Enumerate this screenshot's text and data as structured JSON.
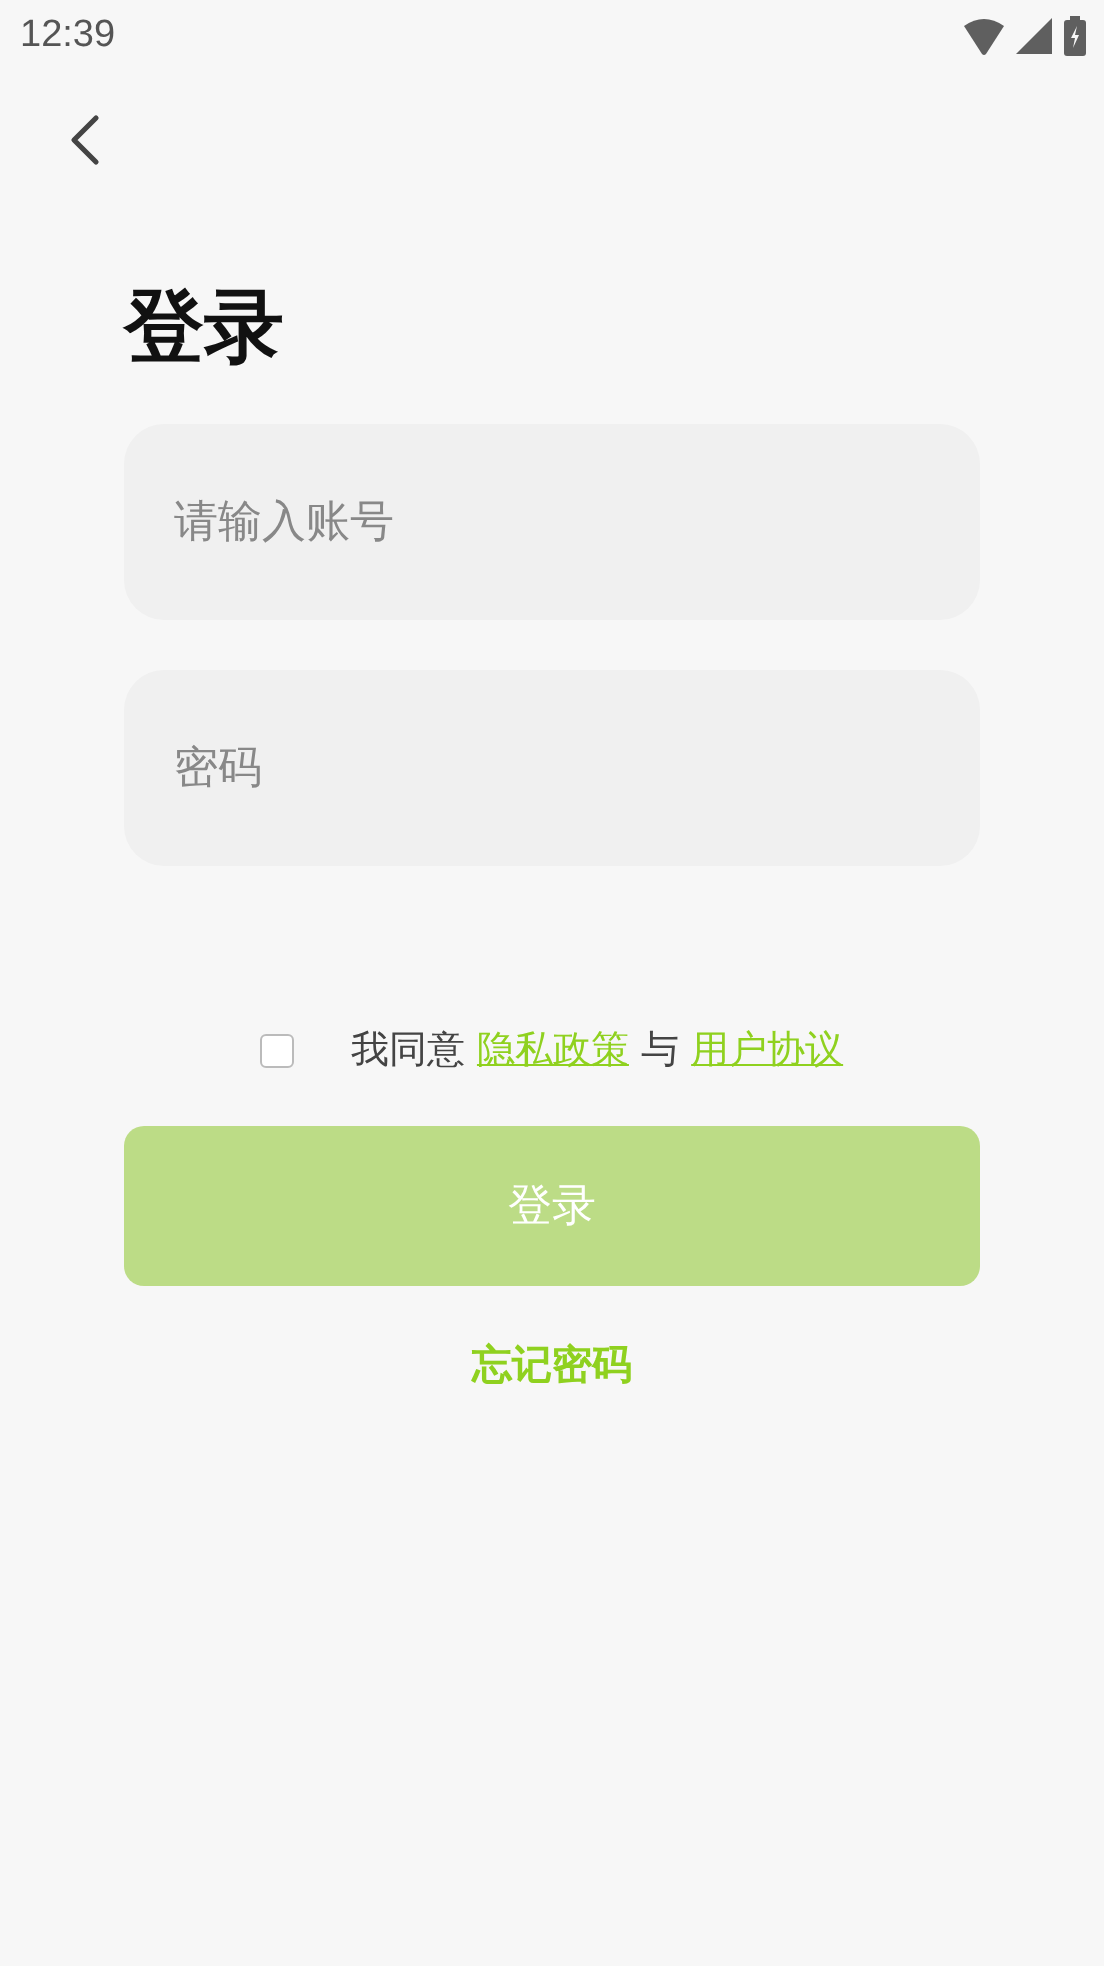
{
  "status_bar": {
    "time": "12:39"
  },
  "title": "登录",
  "fields": [
    {
      "placeholder": "请输入账号"
    },
    {
      "placeholder": "密码"
    }
  ],
  "agreement": {
    "checked": false,
    "parts": [
      {
        "kind": "text",
        "text": "我同意"
      },
      {
        "kind": "link",
        "text": "隐私政策"
      },
      {
        "kind": "text",
        "text": "与"
      },
      {
        "kind": "link",
        "text": "用户协议"
      }
    ]
  },
  "login_button": {
    "label": "登录",
    "disabled": true
  },
  "forgot_link": "忘记密码"
}
